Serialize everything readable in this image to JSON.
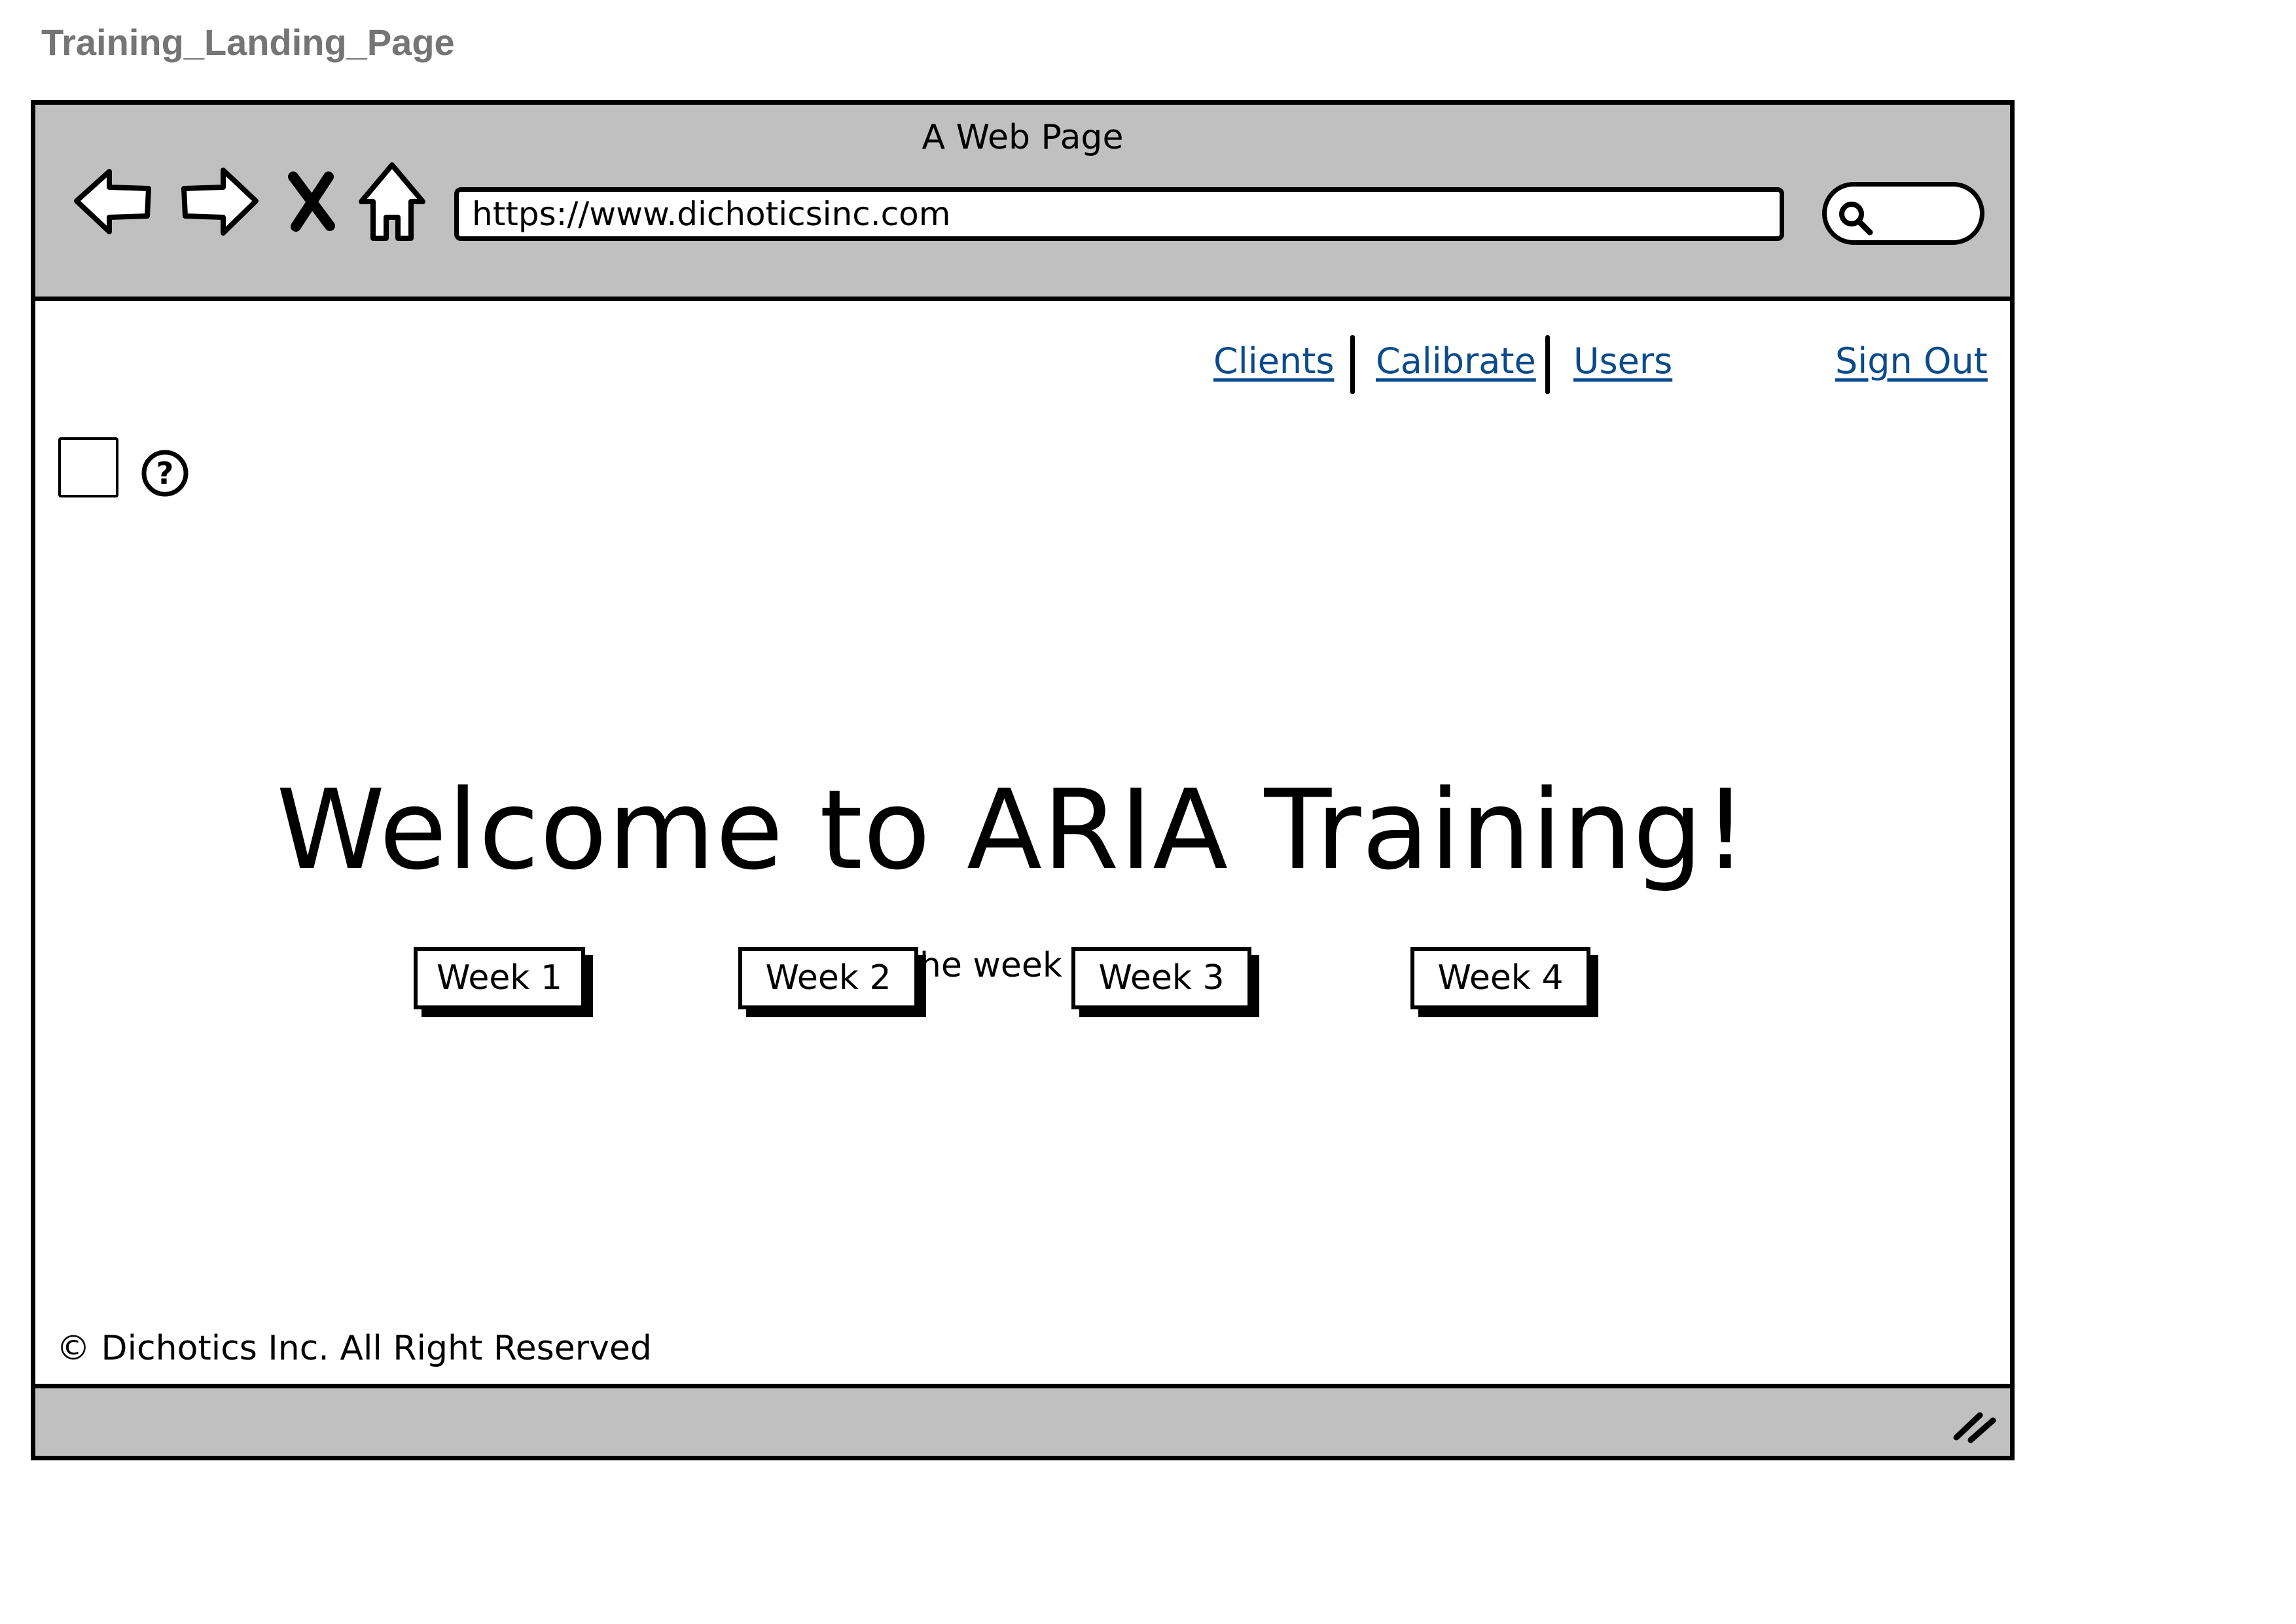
{
  "page_label": "Training_Landing_Page",
  "browser": {
    "window_title": "A Web Page",
    "url": "https://www.dichoticsinc.com",
    "icons": [
      "back-arrow-icon",
      "forward-arrow-icon",
      "stop-icon",
      "home-icon",
      "search-icon",
      "resize-grip-icon"
    ]
  },
  "nav": {
    "links": [
      "Clients",
      "Calibrate",
      "Users"
    ],
    "sign_out": "Sign Out",
    "link_color": "#0b4a8b"
  },
  "main": {
    "heading": "Welcome to ARIA Training!",
    "subtitle": "Choose the week you are on",
    "weeks": [
      "Week 1",
      "Week 2",
      "Week 3",
      "Week 4"
    ]
  },
  "footer": {
    "text": "© Dichotics Inc. All Right Reserved"
  },
  "colors": {
    "chrome_gray": "#c0c0c0",
    "label_gray": "#757575"
  }
}
